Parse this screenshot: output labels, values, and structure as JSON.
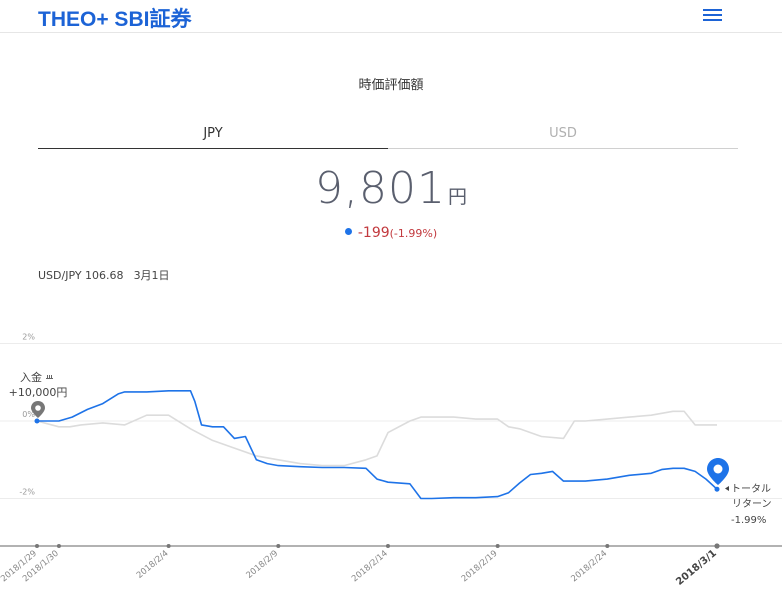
{
  "header": {
    "logo": "THEO+ SBI証券",
    "menu_icon": "hamburger-menu-icon"
  },
  "section_title": "時価評価額",
  "tabs": [
    {
      "label": "JPY",
      "active": true
    },
    {
      "label": "USD",
      "active": false
    }
  ],
  "valuation": {
    "amount": "9,801",
    "unit": "円",
    "change": "-199",
    "change_pct": "(-1.99%)"
  },
  "fx": {
    "rate": "USD/JPY 106.68",
    "date": "3月1日"
  },
  "deposit_annotation": {
    "label": "入金",
    "amount": "+10,000円",
    "icon": "deposit-pin-icon"
  },
  "total_return_annotation": {
    "line1": "トータル",
    "line2": "リターン",
    "value": "-1.99%",
    "icon": "current-location-pin-icon"
  },
  "colors": {
    "brand": "#1c63d6",
    "series": "#1e73e8",
    "benchmark": "#dcdcdc",
    "negative": "#c2393e"
  },
  "chart_data": {
    "type": "line",
    "ylim": [
      -3.2,
      2
    ],
    "yticks": [
      {
        "v": 2,
        "label": "2%"
      },
      {
        "v": 0,
        "label": "0%"
      },
      {
        "v": -2,
        "label": "-2%"
      }
    ],
    "xlim": [
      0,
      31
    ],
    "xticks": [
      {
        "d": 0,
        "label": "2018/1/29",
        "bold": false
      },
      {
        "d": 1,
        "label": "2018/1/30",
        "bold": false
      },
      {
        "d": 6,
        "label": "2018/2/4",
        "bold": false
      },
      {
        "d": 11,
        "label": "2018/2/9",
        "bold": false
      },
      {
        "d": 16,
        "label": "2018/2/14",
        "bold": false
      },
      {
        "d": 21,
        "label": "2018/2/19",
        "bold": false
      },
      {
        "d": 26,
        "label": "2018/2/24",
        "bold": false
      },
      {
        "d": 31,
        "label": "2018/3/1",
        "bold": true
      }
    ],
    "series": [
      {
        "color": "#1e73e8",
        "x": [
          0,
          1,
          1.6,
          2.3,
          3,
          3.7,
          4,
          5,
          6,
          7,
          7.2,
          7.5,
          8,
          8.5,
          9,
          9.5,
          10,
          10.5,
          11,
          12,
          13,
          14,
          15,
          15.5,
          16,
          17,
          17.5,
          18,
          19,
          20,
          21,
          21.5,
          22,
          22.5,
          23,
          23.5,
          24,
          25,
          26,
          27,
          28,
          28.5,
          29,
          29.5,
          30,
          30.5,
          31
        ],
        "y": [
          0,
          0,
          0.1,
          0.3,
          0.45,
          0.7,
          0.75,
          0.75,
          0.78,
          0.78,
          0.5,
          -0.1,
          -0.15,
          -0.15,
          -0.45,
          -0.4,
          -1.0,
          -1.1,
          -1.15,
          -1.18,
          -1.2,
          -1.2,
          -1.22,
          -1.5,
          -1.58,
          -1.62,
          -2.0,
          -2.0,
          -1.98,
          -1.98,
          -1.95,
          -1.85,
          -1.6,
          -1.38,
          -1.35,
          -1.3,
          -1.55,
          -1.55,
          -1.5,
          -1.4,
          -1.35,
          -1.25,
          -1.22,
          -1.22,
          -1.3,
          -1.5,
          -1.76
        ]
      },
      {
        "color": "#dcdcdc",
        "x": [
          0,
          1,
          1.5,
          2,
          3,
          4,
          5,
          6,
          7,
          8,
          9,
          10,
          11,
          12,
          13,
          14,
          15,
          15.5,
          16,
          17,
          17.5,
          18,
          19,
          20,
          21,
          21.5,
          22,
          22.5,
          23,
          24,
          24.5,
          25,
          26,
          27,
          28,
          29,
          29.5,
          30,
          30.5,
          31
        ],
        "y": [
          0,
          -0.15,
          -0.15,
          -0.1,
          -0.05,
          -0.1,
          0.15,
          0.15,
          -0.2,
          -0.5,
          -0.7,
          -0.9,
          -1.0,
          -1.1,
          -1.15,
          -1.15,
          -1.0,
          -0.9,
          -0.3,
          0.0,
          0.1,
          0.1,
          0.1,
          0.05,
          0.05,
          -0.15,
          -0.2,
          -0.3,
          -0.4,
          -0.45,
          0.0,
          0.0,
          0.05,
          0.1,
          0.15,
          0.25,
          0.25,
          -0.1,
          -0.1,
          -0.1
        ]
      }
    ]
  }
}
